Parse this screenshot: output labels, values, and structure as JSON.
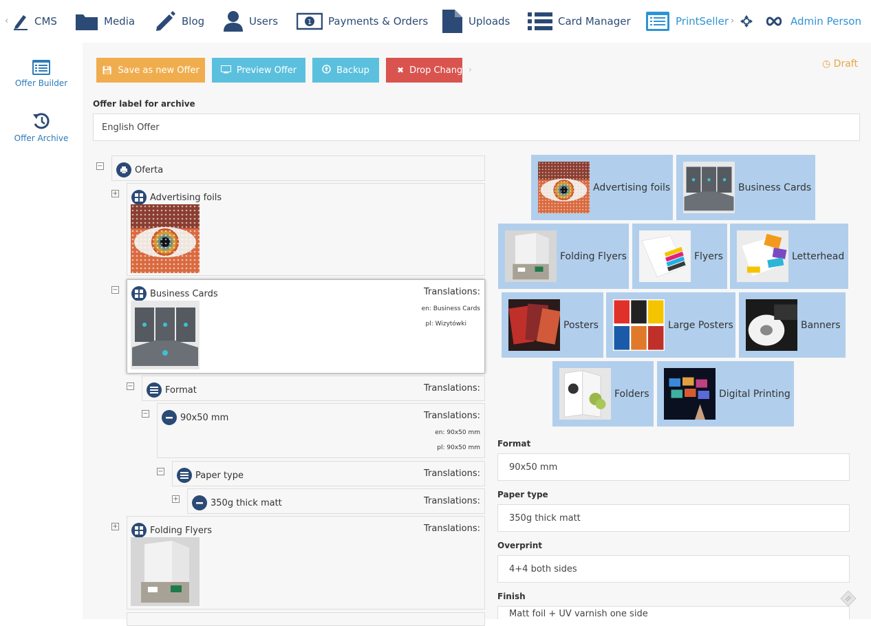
{
  "nav": {
    "items": [
      {
        "label": "CMS",
        "icon": "pen-icon"
      },
      {
        "label": "Media",
        "icon": "folder-icon"
      },
      {
        "label": "Blog",
        "icon": "pencil-icon"
      },
      {
        "label": "Users",
        "icon": "user-icon"
      },
      {
        "label": "Payments & Orders",
        "icon": "money-icon"
      },
      {
        "label": "Uploads",
        "icon": "file-icon"
      },
      {
        "label": "Card Manager",
        "icon": "list-icon"
      },
      {
        "label": "PrintSeller",
        "icon": "list-alt-icon"
      }
    ],
    "user": "Admin Person"
  },
  "sidebar": {
    "items": [
      {
        "label": "Offer Builder",
        "icon": "list-alt-icon"
      },
      {
        "label": "Offer Archive",
        "icon": "history-icon"
      }
    ]
  },
  "toolbar": {
    "save_new": "Save as new Offer",
    "preview": "Preview Offer",
    "backup": "Backup",
    "drop": "Drop Changes"
  },
  "status": "Draft",
  "archive": {
    "label": "Offer label for archive",
    "value": "English Offer"
  },
  "tree": {
    "root": "Oferta",
    "advertising_foils": "Advertising foils",
    "business_cards": {
      "title": "Business Cards",
      "translations": "Translations:",
      "en": "en: Business Cards",
      "pl": "pl: Wizytówki"
    },
    "format": {
      "title": "Format",
      "translations": "Translations:"
    },
    "size": {
      "title": "90x50 mm",
      "translations": "Translations:",
      "en": "en: 90x50 mm",
      "pl": "pl: 90x50 mm"
    },
    "paper_type": {
      "title": "Paper type",
      "translations": "Translations:"
    },
    "paper": {
      "title": "350g thick matt",
      "translations": "Translations:"
    },
    "folding_flyers": {
      "title": "Folding Flyers",
      "translations": "Translations:"
    }
  },
  "tiles": [
    "Advertising foils",
    "Business Cards",
    "Folding Flyers",
    "Flyers",
    "Letterhead",
    "Posters",
    "Large Posters",
    "Banners",
    "Folders",
    "Digital Printing"
  ],
  "form": {
    "format": {
      "label": "Format",
      "value": "90x50 mm"
    },
    "paper_type": {
      "label": "Paper type",
      "value": "350g thick matt"
    },
    "overprint": {
      "label": "Overprint",
      "value": "4+4 both sides"
    },
    "finish": {
      "label": "Finish",
      "value": "Matt foil + UV varnish one side"
    }
  },
  "colors": {
    "nav_text": "#2b4a75",
    "active": "#2c93d4",
    "save": "#f0ad4e",
    "preview": "#5bc0de",
    "drop": "#d9534f",
    "tile_bg": "#b1cfec",
    "draft": "#e8a543"
  }
}
